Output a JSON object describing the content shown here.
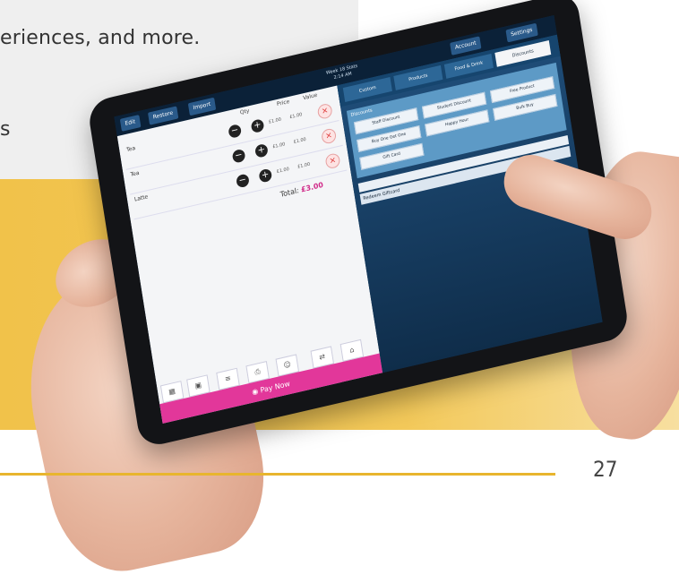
{
  "page": {
    "headline_fragment": "eriences, and more.",
    "side_fragment": "s",
    "page_number": "27"
  },
  "tablet_app": {
    "topbar": {
      "buttons": [
        "Edit",
        "Restore",
        "Import"
      ],
      "center_title_line1": "Week 18 Stats",
      "center_title_line2": "2:14 AM",
      "right_buttons": [
        "Account",
        "Settings"
      ]
    },
    "order": {
      "column_headers": [
        "Qty",
        "Price",
        "Value"
      ],
      "items": [
        {
          "name": "Tea",
          "sub": "",
          "price": "£1.00",
          "value": "£1.00"
        },
        {
          "name": "Tea",
          "sub": "",
          "price": "£1.00",
          "value": "£1.00"
        },
        {
          "name": "Latte",
          "sub": "",
          "price": "£1.00",
          "value": "£1.00"
        }
      ],
      "total_label": "Total:",
      "total_amount": "£3.00",
      "bottom_icons": [
        "calendar-icon",
        "save-icon",
        "list-icon",
        "print-icon",
        "person-icon",
        "sync-icon",
        "more-icon"
      ],
      "pay_label": "Pay Now"
    },
    "catalog": {
      "tabs": [
        "Custom",
        "Products",
        "Food & Drink",
        "Discounts"
      ],
      "active_tab_index": 3,
      "panel_title": "Discounts",
      "discount_buttons": [
        "Staff Discount",
        "Student Discount",
        "Free Product",
        "Buy One Get One",
        "Happy Hour",
        "Bulk Buy",
        "Gift Card"
      ],
      "gift_label": "Redeem Giftcard"
    }
  }
}
